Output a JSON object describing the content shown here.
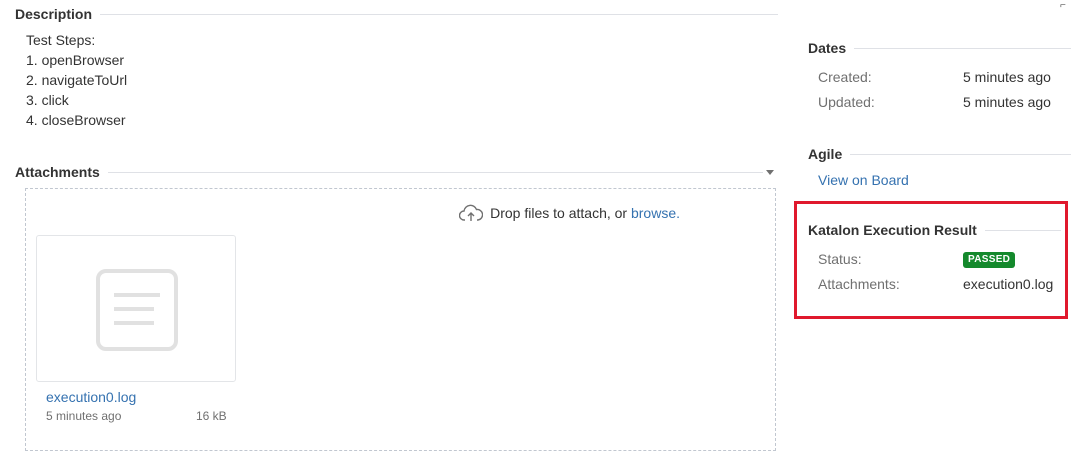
{
  "description": {
    "heading": "Description",
    "lines": [
      "Test Steps:",
      "1. openBrowser",
      "2. navigateToUrl",
      "3. click",
      "4. closeBrowser"
    ]
  },
  "attachments": {
    "heading": "Attachments",
    "drop_text": "Drop files to attach, or ",
    "browse_label": "browse.",
    "file": {
      "name": "execution0.log",
      "time": "5 minutes ago",
      "size": "16 kB"
    },
    "icons": [
      "cloud-upload-icon",
      "document-icon",
      "chevron-down-icon"
    ]
  },
  "dates": {
    "heading": "Dates",
    "created_label": "Created:",
    "created_value": "5 minutes ago",
    "updated_label": "Updated:",
    "updated_value": "5 minutes ago"
  },
  "agile": {
    "heading": "Agile",
    "link_label": "View on Board"
  },
  "katalon": {
    "heading": "Katalon Execution Result",
    "status_label": "Status:",
    "status_value": "PASSED",
    "attachments_label": "Attachments:",
    "attachments_link": "execution0.log"
  },
  "colors": {
    "link": "#3572b0",
    "passed": "#14892c",
    "highlight": "#e0182d"
  }
}
